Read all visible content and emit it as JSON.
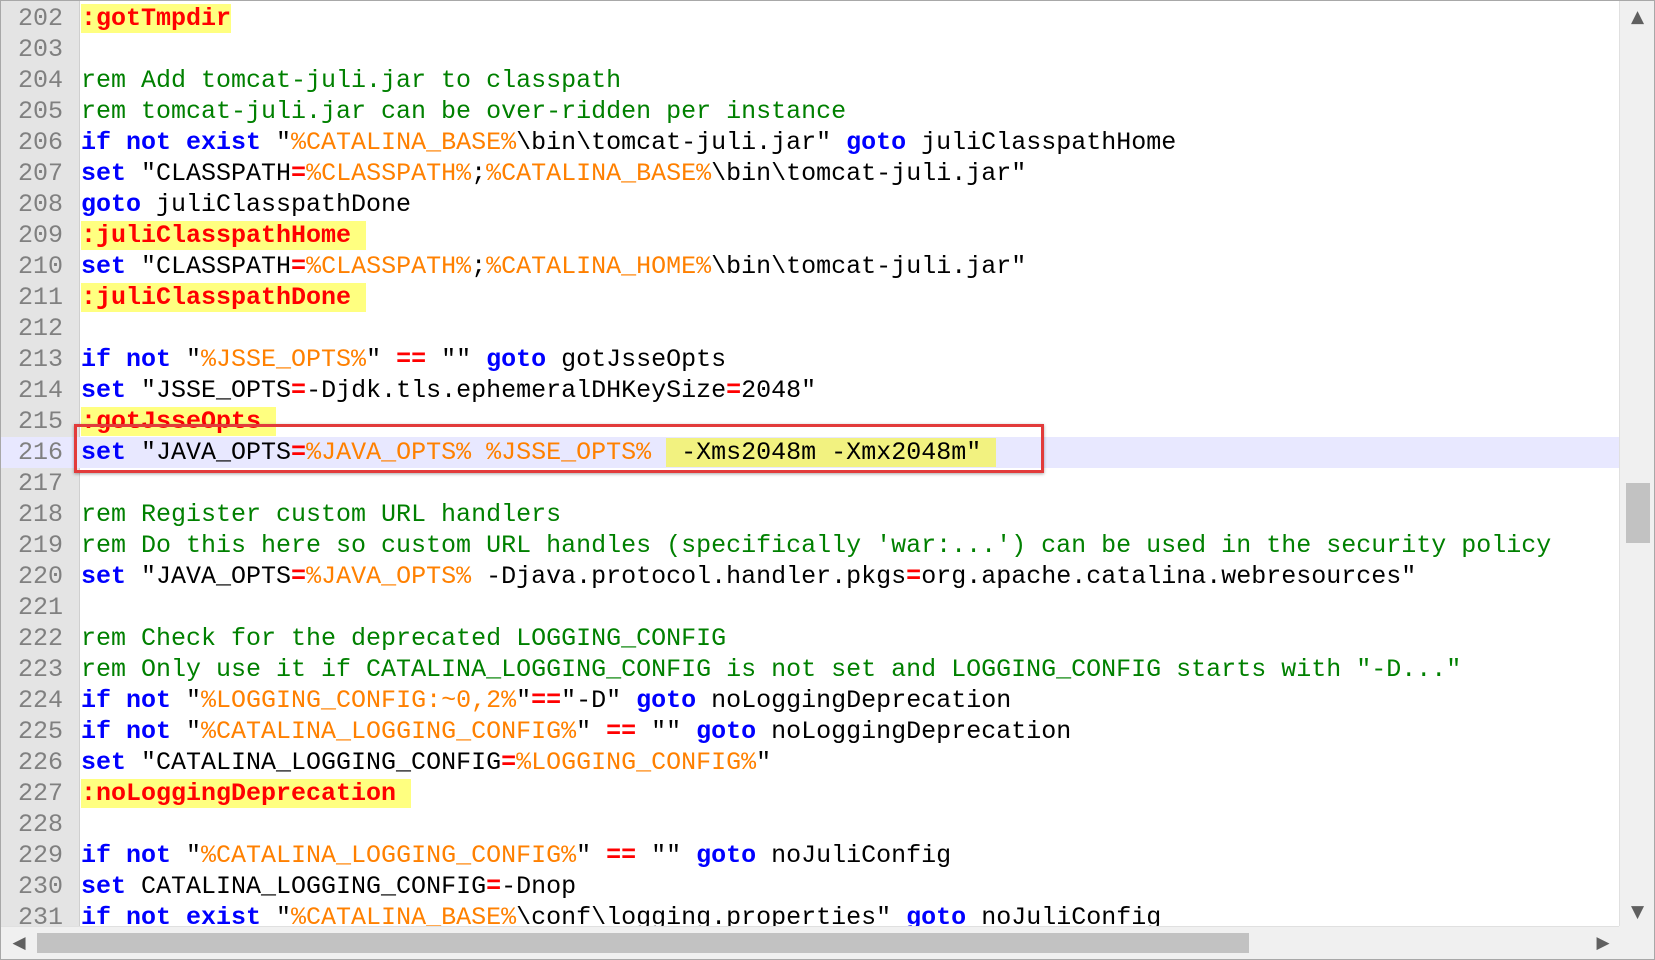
{
  "editor": {
    "lines": [
      {
        "num": "202",
        "tokens": [
          {
            "t": ":gotTmpdir",
            "c": "lbl"
          }
        ]
      },
      {
        "num": "203",
        "tokens": []
      },
      {
        "num": "204",
        "tokens": [
          {
            "t": "rem Add tomcat-juli.jar to classpath",
            "c": "cmt"
          }
        ]
      },
      {
        "num": "205",
        "tokens": [
          {
            "t": "rem tomcat-juli.jar can be over-ridden per instance",
            "c": "cmt"
          }
        ]
      },
      {
        "num": "206",
        "tokens": [
          {
            "t": "if not exist",
            "c": "kw"
          },
          {
            "t": " \"",
            "c": "str"
          },
          {
            "t": "%CATALINA_BASE%",
            "c": "var"
          },
          {
            "t": "\\bin\\tomcat-juli.jar\" ",
            "c": "str"
          },
          {
            "t": "goto",
            "c": "kw"
          },
          {
            "t": " juliClasspathHome",
            "c": "plain"
          }
        ]
      },
      {
        "num": "207",
        "tokens": [
          {
            "t": "set",
            "c": "kw"
          },
          {
            "t": " \"CLASSPATH",
            "c": "str"
          },
          {
            "t": "=",
            "c": "op"
          },
          {
            "t": "%CLASSPATH%",
            "c": "var"
          },
          {
            "t": ";",
            "c": "str"
          },
          {
            "t": "%CATALINA_BASE%",
            "c": "var"
          },
          {
            "t": "\\bin\\tomcat-juli.jar\"",
            "c": "str"
          }
        ]
      },
      {
        "num": "208",
        "tokens": [
          {
            "t": "goto",
            "c": "kw"
          },
          {
            "t": " juliClasspathDone",
            "c": "plain"
          }
        ]
      },
      {
        "num": "209",
        "tokens": [
          {
            "t": ":juliClasspathHome ",
            "c": "lbl"
          }
        ]
      },
      {
        "num": "210",
        "tokens": [
          {
            "t": "set",
            "c": "kw"
          },
          {
            "t": " \"CLASSPATH",
            "c": "str"
          },
          {
            "t": "=",
            "c": "op"
          },
          {
            "t": "%CLASSPATH%",
            "c": "var"
          },
          {
            "t": ";",
            "c": "str"
          },
          {
            "t": "%CATALINA_HOME%",
            "c": "var"
          },
          {
            "t": "\\bin\\tomcat-juli.jar\"",
            "c": "str"
          }
        ]
      },
      {
        "num": "211",
        "tokens": [
          {
            "t": ":juliClasspathDone ",
            "c": "lbl"
          }
        ]
      },
      {
        "num": "212",
        "tokens": []
      },
      {
        "num": "213",
        "tokens": [
          {
            "t": "if not",
            "c": "kw"
          },
          {
            "t": " \"",
            "c": "str"
          },
          {
            "t": "%JSSE_OPTS%",
            "c": "var"
          },
          {
            "t": "\" ",
            "c": "str"
          },
          {
            "t": "==",
            "c": "op"
          },
          {
            "t": " \"\" ",
            "c": "str"
          },
          {
            "t": "goto",
            "c": "kw"
          },
          {
            "t": " gotJsseOpts",
            "c": "plain"
          }
        ]
      },
      {
        "num": "214",
        "tokens": [
          {
            "t": "set",
            "c": "kw"
          },
          {
            "t": " \"JSSE_OPTS",
            "c": "str"
          },
          {
            "t": "=",
            "c": "op"
          },
          {
            "t": "-Djdk.tls.ephemeralDHKeySize",
            "c": "str"
          },
          {
            "t": "=",
            "c": "op"
          },
          {
            "t": "2048\"",
            "c": "str"
          }
        ]
      },
      {
        "num": "215",
        "tokens": [
          {
            "t": ":gotJsseOpts ",
            "c": "lbl"
          }
        ]
      },
      {
        "num": "216",
        "current": true,
        "tokens": [
          {
            "t": "set",
            "c": "kw"
          },
          {
            "t": " \"JAVA_OPTS",
            "c": "str"
          },
          {
            "t": "=",
            "c": "op"
          },
          {
            "t": "%JAVA_OPTS%",
            "c": "var"
          },
          {
            "t": " ",
            "c": "str"
          },
          {
            "t": "%JSSE_OPTS%",
            "c": "var"
          },
          {
            "t": " ",
            "c": "str"
          },
          {
            "t": " -Xms2048m -Xmx2048m\" ",
            "c": "hl"
          }
        ]
      },
      {
        "num": "217",
        "tokens": []
      },
      {
        "num": "218",
        "tokens": [
          {
            "t": "rem Register custom URL handlers",
            "c": "cmt"
          }
        ]
      },
      {
        "num": "219",
        "tokens": [
          {
            "t": "rem Do this here so custom URL handles (specifically 'war:...') can be used in the security policy",
            "c": "cmt"
          }
        ]
      },
      {
        "num": "220",
        "tokens": [
          {
            "t": "set",
            "c": "kw"
          },
          {
            "t": " \"JAVA_OPTS",
            "c": "str"
          },
          {
            "t": "=",
            "c": "op"
          },
          {
            "t": "%JAVA_OPTS%",
            "c": "var"
          },
          {
            "t": " -Djava.protocol.handler.pkgs",
            "c": "str"
          },
          {
            "t": "=",
            "c": "op"
          },
          {
            "t": "org.apache.catalina.webresources\"",
            "c": "str"
          }
        ]
      },
      {
        "num": "221",
        "tokens": []
      },
      {
        "num": "222",
        "tokens": [
          {
            "t": "rem Check for the deprecated LOGGING_CONFIG",
            "c": "cmt"
          }
        ]
      },
      {
        "num": "223",
        "tokens": [
          {
            "t": "rem Only use it if CATALINA_LOGGING_CONFIG is not set and LOGGING_CONFIG starts with \"-D...\"",
            "c": "cmt"
          }
        ]
      },
      {
        "num": "224",
        "tokens": [
          {
            "t": "if not",
            "c": "kw"
          },
          {
            "t": " \"",
            "c": "str"
          },
          {
            "t": "%LOGGING_CONFIG:~0,2%",
            "c": "var"
          },
          {
            "t": "\"",
            "c": "str"
          },
          {
            "t": "==",
            "c": "op"
          },
          {
            "t": "\"-D\" ",
            "c": "str"
          },
          {
            "t": "goto",
            "c": "kw"
          },
          {
            "t": " noLoggingDeprecation",
            "c": "plain"
          }
        ]
      },
      {
        "num": "225",
        "tokens": [
          {
            "t": "if not",
            "c": "kw"
          },
          {
            "t": " \"",
            "c": "str"
          },
          {
            "t": "%CATALINA_LOGGING_CONFIG%",
            "c": "var"
          },
          {
            "t": "\" ",
            "c": "str"
          },
          {
            "t": "==",
            "c": "op"
          },
          {
            "t": " \"\" ",
            "c": "str"
          },
          {
            "t": "goto",
            "c": "kw"
          },
          {
            "t": " noLoggingDeprecation",
            "c": "plain"
          }
        ]
      },
      {
        "num": "226",
        "tokens": [
          {
            "t": "set",
            "c": "kw"
          },
          {
            "t": " \"CATALINA_LOGGING_CONFIG",
            "c": "str"
          },
          {
            "t": "=",
            "c": "op"
          },
          {
            "t": "%LOGGING_CONFIG%",
            "c": "var"
          },
          {
            "t": "\"",
            "c": "str"
          }
        ]
      },
      {
        "num": "227",
        "tokens": [
          {
            "t": ":noLoggingDeprecation ",
            "c": "lbl"
          }
        ]
      },
      {
        "num": "228",
        "tokens": []
      },
      {
        "num": "229",
        "tokens": [
          {
            "t": "if not",
            "c": "kw"
          },
          {
            "t": " \"",
            "c": "str"
          },
          {
            "t": "%CATALINA_LOGGING_CONFIG%",
            "c": "var"
          },
          {
            "t": "\" ",
            "c": "str"
          },
          {
            "t": "==",
            "c": "op"
          },
          {
            "t": " \"\" ",
            "c": "str"
          },
          {
            "t": "goto",
            "c": "kw"
          },
          {
            "t": " noJuliConfig",
            "c": "plain"
          }
        ]
      },
      {
        "num": "230",
        "tokens": [
          {
            "t": "set",
            "c": "kw"
          },
          {
            "t": " CATALINA_LOGGING_CONFIG",
            "c": "str"
          },
          {
            "t": "=",
            "c": "op"
          },
          {
            "t": "-Dnop",
            "c": "str"
          }
        ]
      },
      {
        "num": "231",
        "tokens": [
          {
            "t": "if not exist",
            "c": "kw"
          },
          {
            "t": " \"",
            "c": "str"
          },
          {
            "t": "%CATALINA_BASE%",
            "c": "var"
          },
          {
            "t": "\\conf\\logging.properties\" ",
            "c": "str"
          },
          {
            "t": "goto",
            "c": "kw"
          },
          {
            "t": " noJuliConfig",
            "c": "plain"
          }
        ]
      }
    ]
  },
  "scrollbars": {
    "up_arrow": "▲",
    "down_arrow": "▼",
    "left_arrow": "◀",
    "right_arrow": "▶"
  }
}
